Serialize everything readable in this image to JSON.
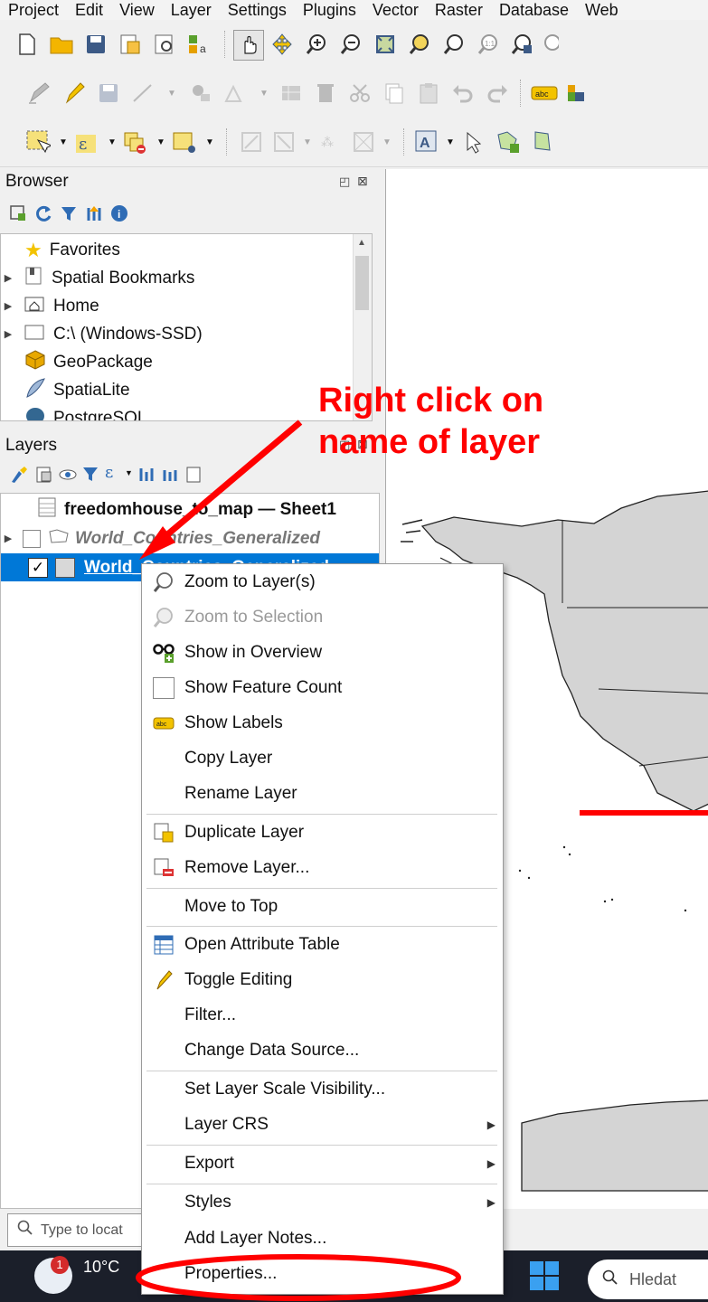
{
  "menubar": {
    "items": [
      "Project",
      "Edit",
      "View",
      "Layer",
      "Settings",
      "Plugins",
      "Vector",
      "Raster",
      "Database",
      "Web"
    ]
  },
  "browser": {
    "title": "Browser",
    "items": [
      {
        "label": "Favorites",
        "icon": "star-icon",
        "expandable": false
      },
      {
        "label": "Spatial Bookmarks",
        "icon": "bookmark-icon",
        "expandable": true
      },
      {
        "label": "Home",
        "icon": "home-folder-icon",
        "expandable": true
      },
      {
        "label": "C:\\ (Windows-SSD)",
        "icon": "drive-icon",
        "expandable": true
      },
      {
        "label": "GeoPackage",
        "icon": "geopackage-icon",
        "expandable": false
      },
      {
        "label": "SpatiaLite",
        "icon": "spatialite-icon",
        "expandable": false
      },
      {
        "label": "PostgreSQL",
        "icon": "postgresql-icon",
        "expandable": false
      }
    ]
  },
  "layers": {
    "title": "Layers",
    "items": [
      {
        "label": "freedomhouse_to_map — Sheet1",
        "bold": true
      },
      {
        "label": "World_Countries_Generalized",
        "italic": true
      },
      {
        "label": "World_Countries_Generalized",
        "selected": true
      }
    ]
  },
  "annotation": {
    "line1": "Right click on",
    "line2": "name of layer",
    "color": "#ff0000"
  },
  "context_menu": {
    "items": [
      {
        "label": "Zoom to Layer(s)",
        "icon": "zoom-layer-icon"
      },
      {
        "label": "Zoom to Selection",
        "icon": "zoom-selection-icon",
        "disabled": true
      },
      {
        "label": "Show in Overview",
        "icon": "overview-icon"
      },
      {
        "label": "Show Feature Count",
        "icon": "checkbox-icon"
      },
      {
        "label": "Show Labels",
        "icon": "labels-icon"
      },
      {
        "label": "Copy Layer"
      },
      {
        "label": "Rename Layer"
      },
      {
        "label": "Duplicate Layer",
        "icon": "duplicate-layer-icon"
      },
      {
        "label": "Remove Layer...",
        "icon": "remove-layer-icon"
      },
      {
        "label": "Move to Top"
      },
      {
        "label": "Open Attribute Table",
        "icon": "attribute-table-icon"
      },
      {
        "label": "Toggle Editing",
        "icon": "pencil-icon"
      },
      {
        "label": "Filter..."
      },
      {
        "label": "Change Data Source..."
      },
      {
        "label": "Set Layer Scale Visibility..."
      },
      {
        "label": "Layer CRS",
        "submenu": true
      },
      {
        "label": "Export",
        "submenu": true
      },
      {
        "label": "Styles",
        "submenu": true
      },
      {
        "label": "Add Layer Notes..."
      },
      {
        "label": "Properties..."
      }
    ]
  },
  "locator": {
    "placeholder": "Type to locat"
  },
  "taskbar": {
    "weather_temp": "10°C",
    "notification_count": "1",
    "search_text": "Hledat"
  }
}
